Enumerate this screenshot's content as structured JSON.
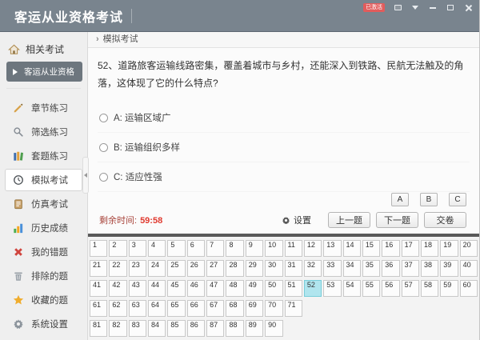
{
  "window": {
    "title": "客运从业资格考试",
    "controls": [
      {
        "name": "activation-badge",
        "label": "已激活"
      },
      {
        "name": "message-icon"
      },
      {
        "name": "dropdown-icon"
      },
      {
        "name": "minimize-icon"
      },
      {
        "name": "maximize-icon"
      },
      {
        "name": "close-icon"
      }
    ]
  },
  "sidebar": {
    "header_label": "相关考试",
    "header_icon": "home-icon",
    "sub_item": {
      "label": "客运从业资格",
      "icon": "play-icon"
    },
    "items": [
      {
        "label": "章节练习",
        "icon": "pencil-icon"
      },
      {
        "label": "筛选练习",
        "icon": "search-icon"
      },
      {
        "label": "套题练习",
        "icon": "books-icon"
      },
      {
        "label": "模拟考试",
        "icon": "clock-icon",
        "selected": true
      },
      {
        "label": "仿真考试",
        "icon": "clipboard-icon"
      },
      {
        "label": "历史成绩",
        "icon": "bar-chart-icon"
      },
      {
        "label": "我的错题",
        "icon": "wrong-answers-icon"
      },
      {
        "label": "排除的题",
        "icon": "trash-icon"
      },
      {
        "label": "收藏的题",
        "icon": "star-icon"
      },
      {
        "label": "系统设置",
        "icon": "gear-icon"
      }
    ]
  },
  "breadcrumb": {
    "arrow": "›",
    "label": "模拟考试"
  },
  "question": {
    "text": "52、道路旅客运输线路密集，覆盖着城市与乡村，还能深入到铁路、民航无法触及的角落，这体现了它的什么特点?",
    "options": [
      {
        "key": "A",
        "label": "A: 运输区域广"
      },
      {
        "key": "B",
        "label": "B: 运输组织多样"
      },
      {
        "key": "C",
        "label": "C: 适应性强"
      }
    ]
  },
  "answer_keys": {
    "a": "A",
    "b": "B",
    "c": "C"
  },
  "toolbar": {
    "timer_label": "剩余时间:",
    "timer_value": "59:58",
    "settings_label": "设置",
    "settings_icon": "gear-icon",
    "prev_label": "上一题",
    "next_label": "下一题",
    "submit_label": "交卷"
  },
  "grid": {
    "selected": "52",
    "cells": [
      1,
      2,
      3,
      4,
      5,
      6,
      7,
      8,
      9,
      10,
      11,
      12,
      13,
      14,
      15,
      16,
      17,
      18,
      19,
      20,
      21,
      22,
      23,
      24,
      25,
      26,
      27,
      28,
      29,
      30,
      31,
      32,
      33,
      34,
      35,
      36,
      37,
      38,
      39,
      40,
      41,
      42,
      43,
      44,
      45,
      46,
      47,
      48,
      49,
      50,
      51,
      52,
      53,
      54,
      55,
      56,
      57,
      58,
      59,
      60,
      61,
      62,
      63,
      64,
      65,
      66,
      67,
      68,
      69,
      70,
      71,
      "",
      "",
      "",
      "",
      "",
      "",
      "",
      "",
      "",
      81,
      82,
      83,
      84,
      85,
      86,
      87,
      88,
      89,
      90
    ]
  },
  "colors": {
    "header_bg": "#79848e",
    "badge_bg": "#e25c5c",
    "sidebar_active_sub_bg": "#6d767e",
    "selected_cell_bg": "#b0e5ee",
    "timer_value_color": "#e0392e"
  }
}
